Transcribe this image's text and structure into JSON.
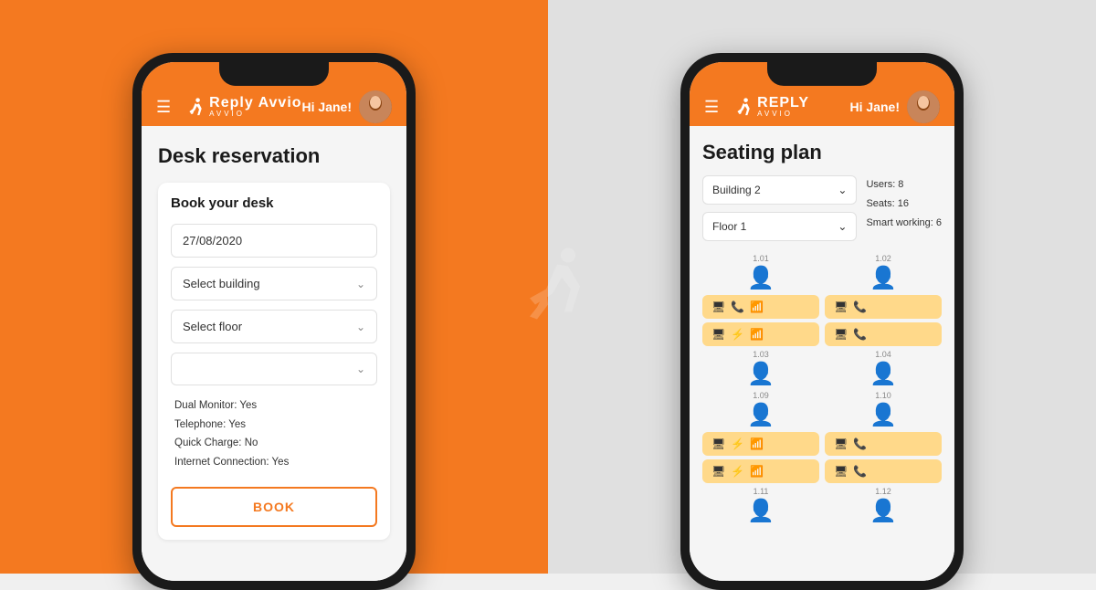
{
  "app": {
    "name": "Reply Avvio",
    "greeting": "Hi Jane!"
  },
  "leftPhone": {
    "title": "Desk reservation",
    "card": {
      "heading": "Book your desk",
      "date": "27/08/2020",
      "building_placeholder": "Select building",
      "floor_placeholder": "Select floor",
      "extra_placeholder": "",
      "features": [
        "Dual Monitor: Yes",
        "Telephone: Yes",
        "Quick Charge: No",
        "Internet Connection: Yes"
      ],
      "book_btn": "BOOK"
    }
  },
  "rightPhone": {
    "title": "Seating plan",
    "building": "Building 2",
    "floor": "Floor 1",
    "stats": {
      "users": "Users: 8",
      "seats": "Seats: 16",
      "smart": "Smart working: 6"
    },
    "seats": [
      {
        "id": "1.01",
        "state": "empty"
      },
      {
        "id": "1.02",
        "state": "empty"
      },
      {
        "id": "amenity1",
        "amenities": [
          "monitor",
          "phone",
          "wifi"
        ]
      },
      {
        "id": "amenity2",
        "amenities": [
          "monitor",
          "phone"
        ]
      },
      {
        "id": "amenity3",
        "amenities": [
          "monitor",
          "bolt",
          "wifi"
        ]
      },
      {
        "id": "amenity4",
        "amenities": [
          "monitor",
          "phone"
        ]
      },
      {
        "id": "1.03",
        "state": "occupied"
      },
      {
        "id": "1.04",
        "state": "empty"
      },
      {
        "id": "1.09",
        "state": "empty"
      },
      {
        "id": "1.10",
        "state": "empty"
      },
      {
        "id": "amenity5",
        "amenities": [
          "monitor",
          "bolt",
          "wifi"
        ]
      },
      {
        "id": "amenity6",
        "amenities": [
          "monitor",
          "phone"
        ]
      },
      {
        "id": "amenity7",
        "amenities": [
          "monitor",
          "bolt",
          "wifi"
        ]
      },
      {
        "id": "amenity8",
        "amenities": [
          "monitor",
          "phone"
        ]
      },
      {
        "id": "1.11",
        "state": "empty"
      },
      {
        "id": "1.12",
        "state": "booked"
      }
    ]
  }
}
